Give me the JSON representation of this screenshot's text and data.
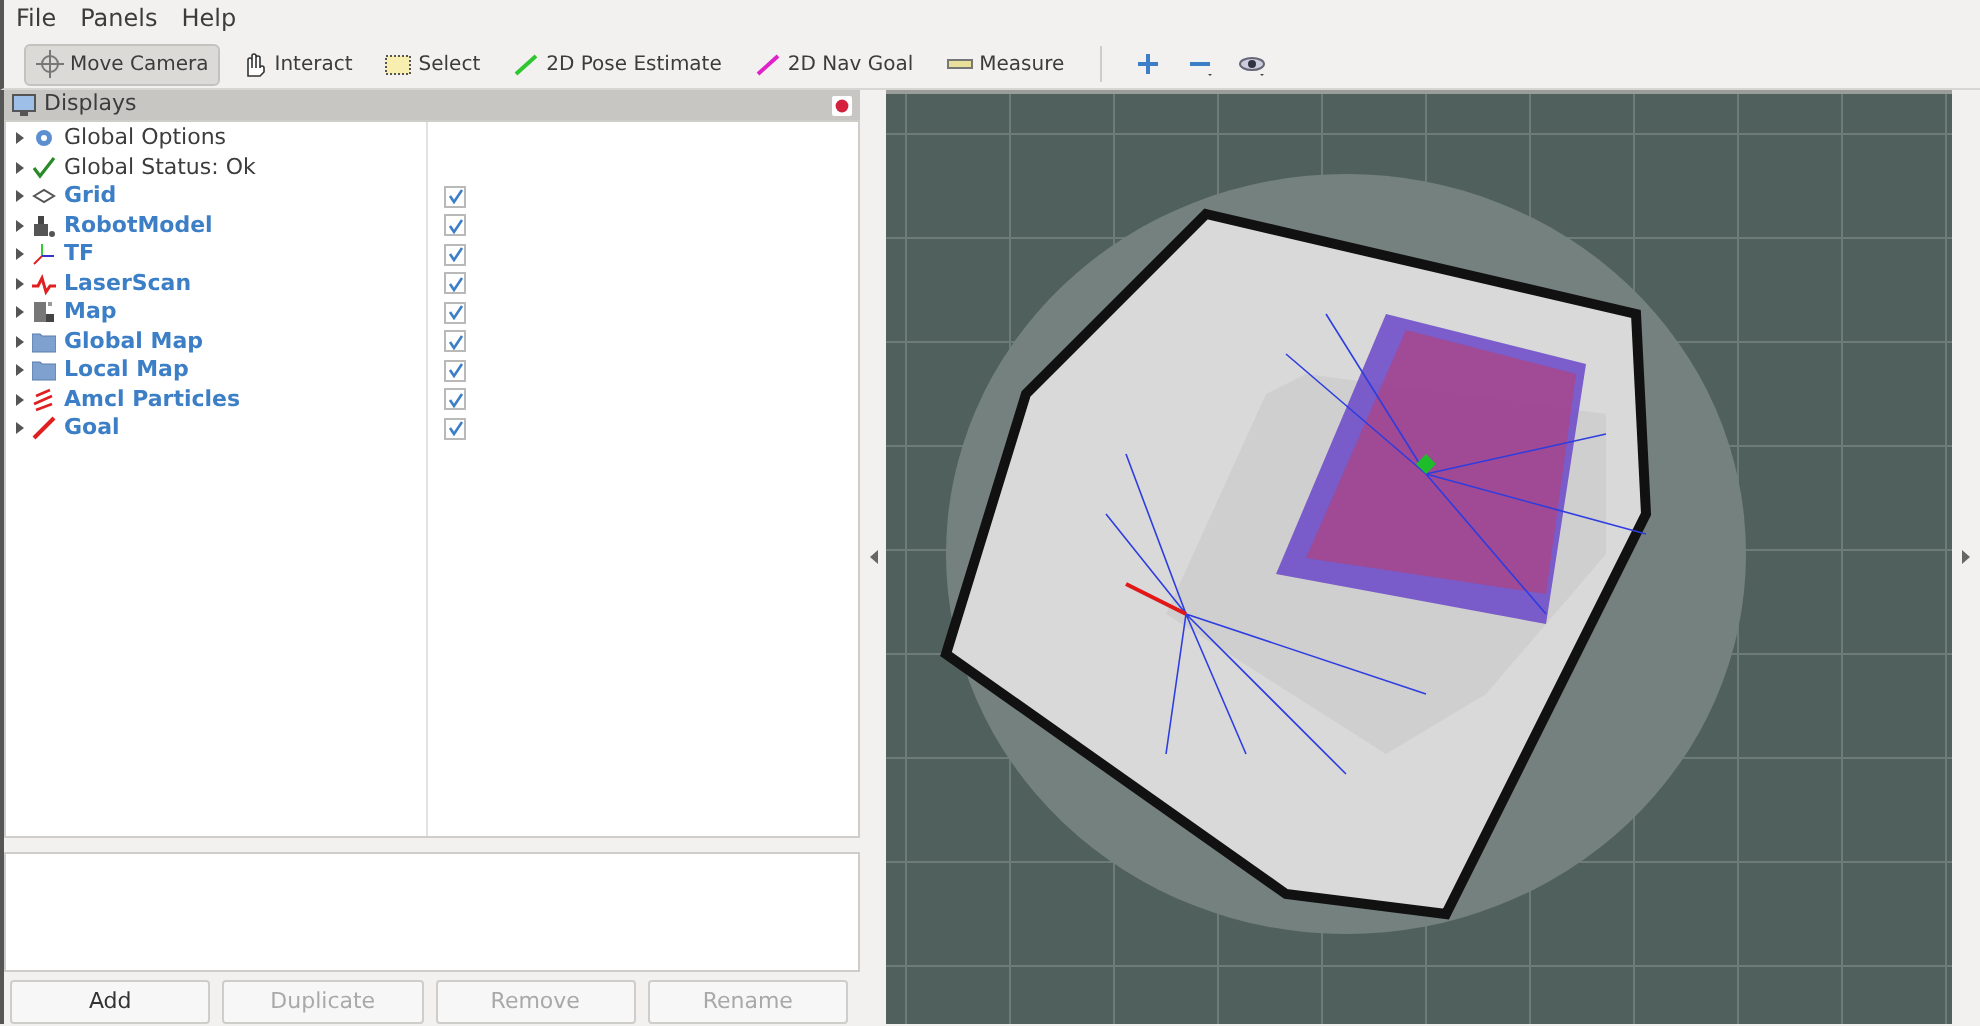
{
  "menu": [
    "File",
    "Panels",
    "Help"
  ],
  "tools": [
    {
      "label": "Move Camera",
      "kind": "move",
      "selected": true
    },
    {
      "label": "Interact",
      "kind": "hand",
      "selected": false
    },
    {
      "label": "Select",
      "kind": "select",
      "selected": false
    },
    {
      "label": "2D Pose Estimate",
      "kind": "pose",
      "selected": false
    },
    {
      "label": "2D Nav Goal",
      "kind": "goal",
      "selected": false
    },
    {
      "label": "Measure",
      "kind": "ruler",
      "selected": false
    }
  ],
  "displays_panel": {
    "title": "Displays",
    "items": [
      {
        "label": "Global Options",
        "kind": "gear"
      },
      {
        "label": "Global Status: Ok",
        "kind": "ok"
      },
      {
        "label": "Grid",
        "kind": "grid",
        "checked": true
      },
      {
        "label": "RobotModel",
        "kind": "robot",
        "checked": true
      },
      {
        "label": "TF",
        "kind": "tf",
        "checked": true
      },
      {
        "label": "LaserScan",
        "kind": "laser",
        "checked": true
      },
      {
        "label": "Map",
        "kind": "map",
        "checked": true
      },
      {
        "label": "Global Map",
        "kind": "folder",
        "checked": true
      },
      {
        "label": "Local Map",
        "kind": "folder",
        "checked": true
      },
      {
        "label": "Amcl Particles",
        "kind": "particles",
        "checked": true
      },
      {
        "label": "Goal",
        "kind": "goal",
        "checked": true
      }
    ],
    "buttons": [
      {
        "label": "Add",
        "disabled": false
      },
      {
        "label": "Duplicate",
        "disabled": true
      },
      {
        "label": "Remove",
        "disabled": true
      },
      {
        "label": "Rename",
        "disabled": true
      }
    ]
  }
}
